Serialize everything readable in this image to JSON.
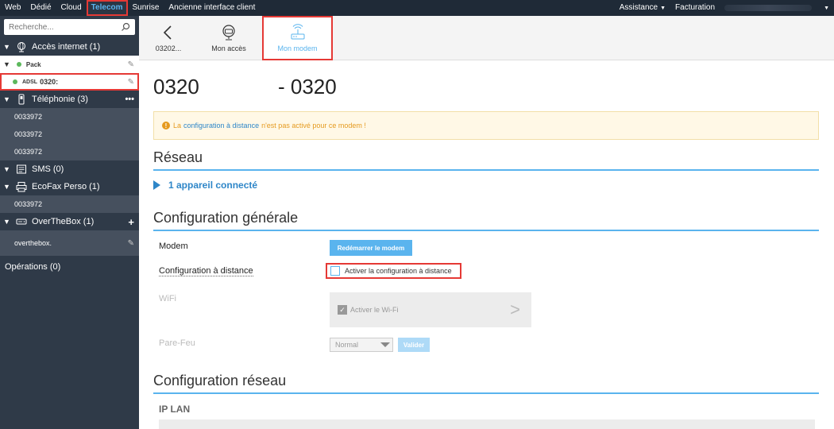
{
  "topnav": {
    "items": [
      "Web",
      "Dédié",
      "Cloud",
      "Telecom",
      "Sunrise",
      "Ancienne interface client"
    ],
    "active": "Telecom",
    "right": [
      "Assistance",
      "Facturation"
    ]
  },
  "sidebar": {
    "search_placeholder": "Recherche...",
    "sections": {
      "acces": "Accès internet (1)",
      "telephonie": "Téléphonie (3)",
      "sms": "SMS (0)",
      "ecofax": "EcoFax Perso (1)",
      "otb": "OverTheBox (1)"
    },
    "pack_label": "Pack",
    "adsl_prefix": "ADSL",
    "adsl_number": "0320:",
    "phone_lines": [
      "0033972",
      "0033972",
      "0033972"
    ],
    "fax_line": "0033972",
    "otb_line": "overthebox.",
    "operations": "Opérations (0)"
  },
  "tabs": {
    "back": "03202...",
    "mon_acces": "Mon accès",
    "mon_modem": "Mon modem"
  },
  "main": {
    "title_left": "0320",
    "title_right": "- 0320",
    "alert": {
      "prefix": "La",
      "link": "configuration à distance",
      "suffix": "n'est pas activé pour ce modem !"
    },
    "reseau_heading": "Réseau",
    "devices_label": "1 appareil connecté",
    "config_heading": "Configuration générale",
    "modem_label": "Modem",
    "restart_button": "Redémarrer le modem",
    "remote_label": "Configuration à distance",
    "remote_checkbox_label": "Activer la configuration à distance",
    "wifi_label": "WiFi",
    "wifi_checkbox_label": "Activer le Wi-Fi",
    "firewall_label": "Pare-Feu",
    "firewall_value": "Normal",
    "validate_button": "Valider",
    "network_heading": "Configuration réseau",
    "ip_lan_heading": "IP LAN"
  }
}
